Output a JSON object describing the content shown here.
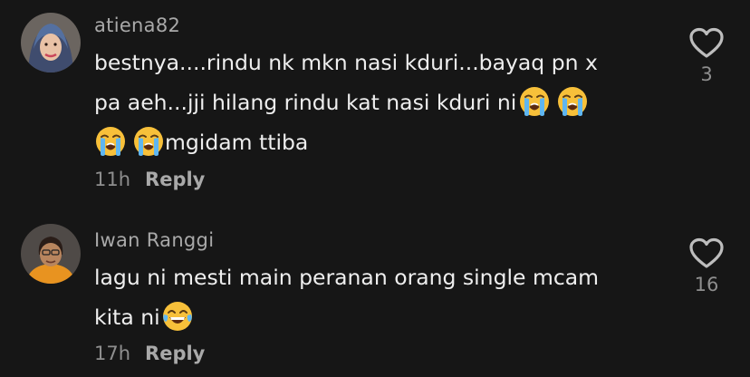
{
  "comments": [
    {
      "username": "atiena82",
      "lines": [
        "bestnya....rindu nk mkn nasi kduri...bayaq pn x",
        "pa aeh...jji hilang rindu kat nasi kduri ni",
        "mgidam ttiba"
      ],
      "time": "11h",
      "reply_label": "Reply",
      "like_count": "3",
      "emojis": [
        "loudly-crying-face",
        "loudly-crying-face",
        "loudly-crying-face",
        "loudly-crying-face"
      ]
    },
    {
      "username": "Iwan Ranggi",
      "lines": [
        "lagu ni mesti main peranan orang single mcam",
        "kita ni"
      ],
      "time": "17h",
      "reply_label": "Reply",
      "like_count": "16",
      "emojis": [
        "face-with-tears-of-joy"
      ]
    }
  ],
  "colors": {
    "background": "#161616",
    "username": "#a9a9a9",
    "text": "#eeeeee",
    "meta": "#8e8e8e"
  }
}
